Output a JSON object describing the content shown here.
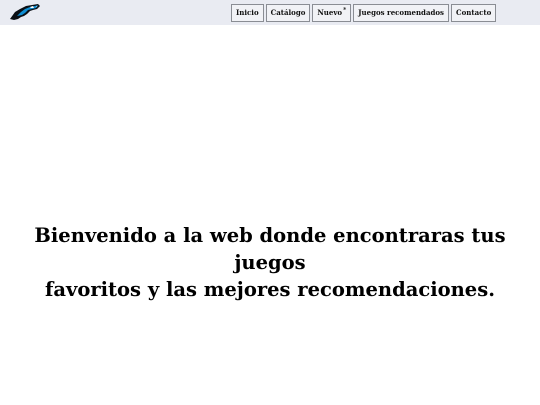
{
  "header": {
    "logo_icon": "panther-logo-icon",
    "nav": [
      {
        "label": "Inicio"
      },
      {
        "label": "Catálogo"
      },
      {
        "label": "Nuevo",
        "badge": "*"
      },
      {
        "label": "Juegos recomendados"
      },
      {
        "label": "Contacto"
      }
    ]
  },
  "main": {
    "welcome_line1": "Bienvenido a la web donde encontraras tus juegos",
    "welcome_line2": "favoritos y las mejores recomendaciones."
  },
  "colors": {
    "topbar_bg": "#e9ebf2",
    "logo_blue": "#0f8ed3",
    "logo_dark": "#0b0f14"
  }
}
